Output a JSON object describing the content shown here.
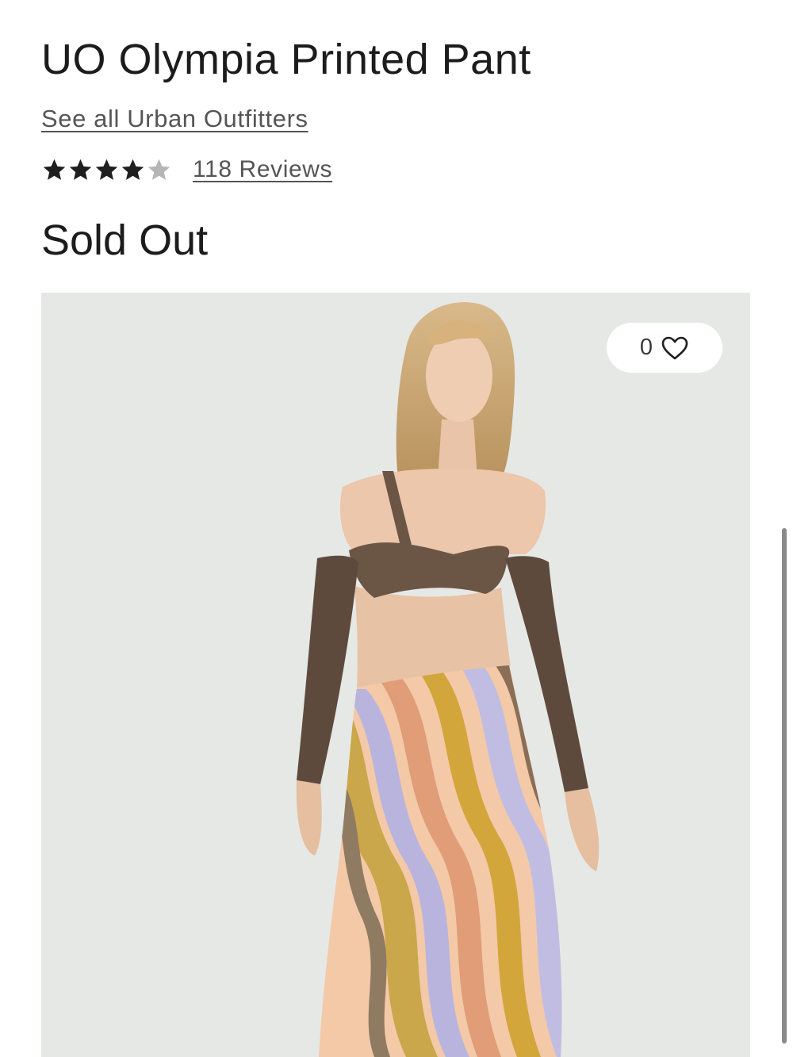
{
  "product": {
    "title": "UO Olympia Printed Pant",
    "brand_link": "See all Urban Outfitters",
    "rating": {
      "value": 4,
      "max": 5
    },
    "reviews_label": "118 Reviews",
    "status": "Sold Out"
  },
  "gallery": {
    "favorite_count": "0",
    "favorite_icon": "heart-outline-icon"
  },
  "colors": {
    "star_filled": "#1f1f1f",
    "star_empty": "#b5b5b5",
    "photo_background": "#e6e8e6"
  }
}
